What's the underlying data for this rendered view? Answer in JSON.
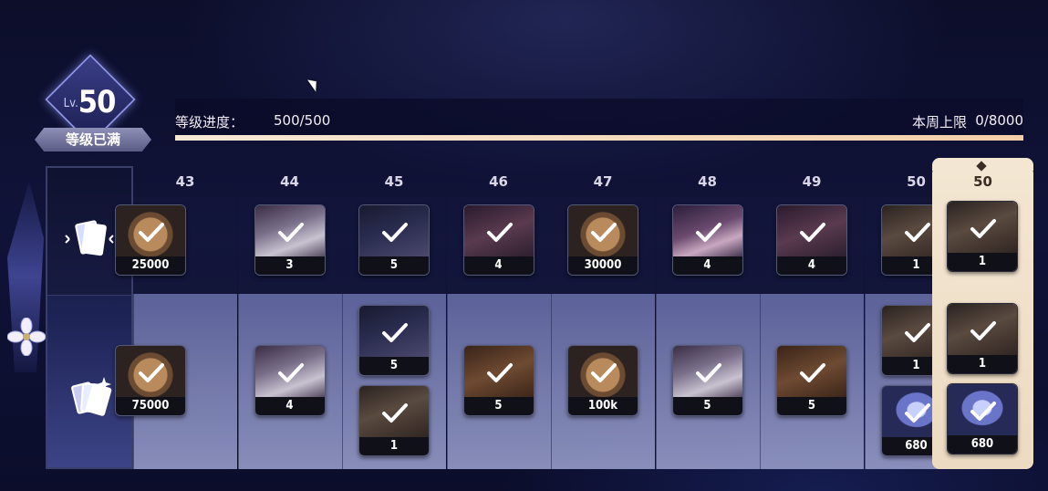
{
  "level": {
    "prefix": "Lv.",
    "number": "50",
    "status": "等级已满"
  },
  "progress": {
    "label": "等级进度：",
    "value": "500/500",
    "fraction": 1.0,
    "cap_label": "本周上限",
    "cap_value": "0/8000"
  },
  "tracks": {
    "free_icon": "card-pack-icon",
    "paid_icon": "card-pack-sparkle-icon"
  },
  "check_icon": "checkmark-icon",
  "columns": [
    {
      "level": "43",
      "free": [
        {
          "type": "coin",
          "qty": "25000"
        }
      ],
      "paid": [
        {
          "type": "coin",
          "qty": "75000"
        }
      ]
    },
    {
      "level": "44",
      "free": [
        {
          "type": "book-silver",
          "qty": "3"
        }
      ],
      "paid": [
        {
          "type": "book-silver",
          "qty": "4"
        }
      ]
    },
    {
      "level": "45",
      "free": [
        {
          "type": "book-dark",
          "qty": "5"
        }
      ],
      "paid": [
        {
          "type": "book-dark",
          "qty": "5"
        },
        {
          "type": "chest",
          "qty": "1"
        }
      ]
    },
    {
      "level": "46",
      "free": [
        {
          "type": "book-red",
          "qty": "4"
        }
      ],
      "paid": [
        {
          "type": "book-brown",
          "qty": "5"
        }
      ]
    },
    {
      "level": "47",
      "free": [
        {
          "type": "coin",
          "qty": "30000"
        }
      ],
      "paid": [
        {
          "type": "coin",
          "qty": "100k"
        }
      ]
    },
    {
      "level": "48",
      "free": [
        {
          "type": "book-pink",
          "qty": "4"
        }
      ],
      "paid": [
        {
          "type": "book-silver",
          "qty": "5"
        }
      ]
    },
    {
      "level": "49",
      "free": [
        {
          "type": "book-red",
          "qty": "4"
        }
      ],
      "paid": [
        {
          "type": "book-brown",
          "qty": "5"
        }
      ]
    },
    {
      "level": "50",
      "free": [
        {
          "type": "chest",
          "qty": "1"
        }
      ],
      "paid": [
        {
          "type": "chest",
          "qty": "1"
        },
        {
          "type": "crystal",
          "qty": "680"
        }
      ]
    }
  ],
  "highlight_column": {
    "level": "50",
    "free": [
      {
        "type": "chest",
        "qty": "1"
      }
    ],
    "paid": [
      {
        "type": "chest",
        "qty": "1"
      },
      {
        "type": "crystal",
        "qty": "680"
      }
    ]
  }
}
